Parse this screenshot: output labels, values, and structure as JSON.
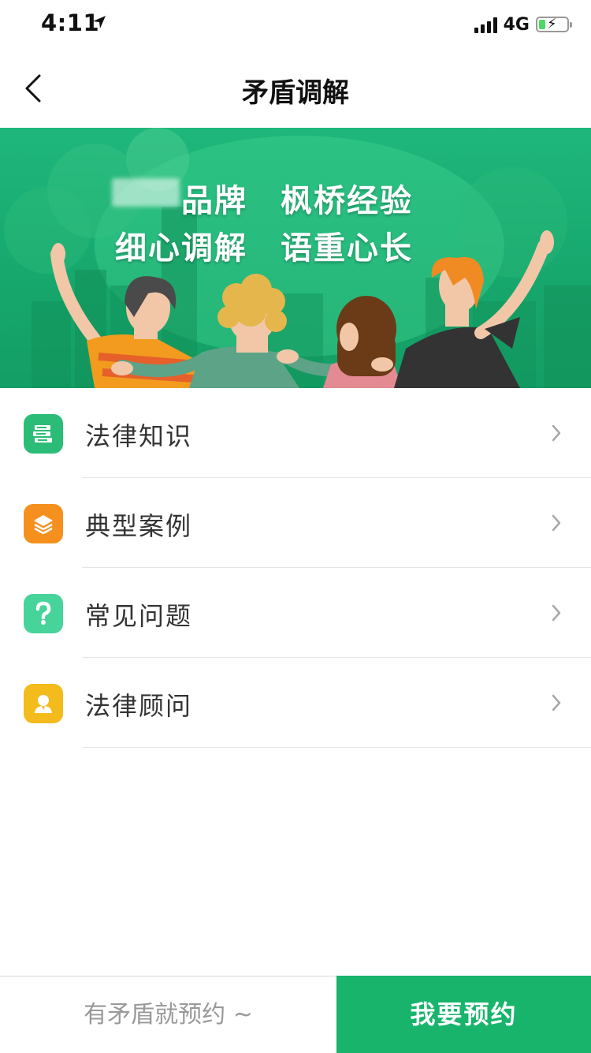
{
  "status_bar": {
    "time": "4:11",
    "network": "4G"
  },
  "nav": {
    "title": "矛盾调解"
  },
  "banner": {
    "line1_a": "品牌",
    "line1_b": "枫桥经验",
    "line2_a": "细心调解",
    "line2_b": "语重心长"
  },
  "menu": {
    "items": [
      {
        "label": "法律知识",
        "icon": "books-icon",
        "color": "#2bbd77"
      },
      {
        "label": "典型案例",
        "icon": "layers-icon",
        "color": "#f5901e"
      },
      {
        "label": "常见问题",
        "icon": "question-icon",
        "color": "#46d49a"
      },
      {
        "label": "法律顾问",
        "icon": "advisor-icon",
        "color": "#f3bb1c"
      }
    ]
  },
  "bottom": {
    "hint": "有矛盾就预约 ~",
    "book_label": "我要预约"
  },
  "colors": {
    "primary": "#18b46c",
    "banner": "#1fb77c"
  }
}
